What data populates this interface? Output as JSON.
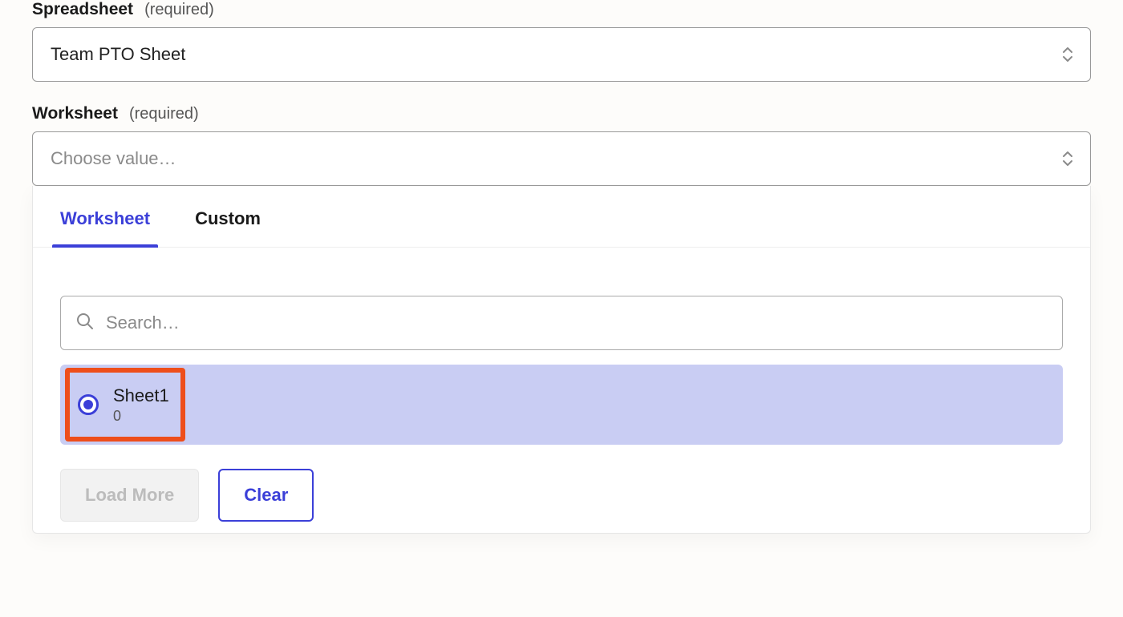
{
  "fields": {
    "spreadsheet": {
      "label": "Spreadsheet",
      "required_text": "(required)",
      "value": "Team PTO Sheet"
    },
    "worksheet": {
      "label": "Worksheet",
      "required_text": "(required)",
      "placeholder": "Choose value…"
    }
  },
  "dropdown": {
    "tabs": {
      "worksheet": "Worksheet",
      "custom": "Custom"
    },
    "search_placeholder": "Search…",
    "options": [
      {
        "title": "Sheet1",
        "sub": "0",
        "selected": true
      }
    ],
    "buttons": {
      "load_more": "Load More",
      "clear": "Clear"
    }
  },
  "colors": {
    "accent": "#3b3fd8",
    "highlight_border": "#ee4e1b",
    "option_bg": "#c9cdf3"
  }
}
